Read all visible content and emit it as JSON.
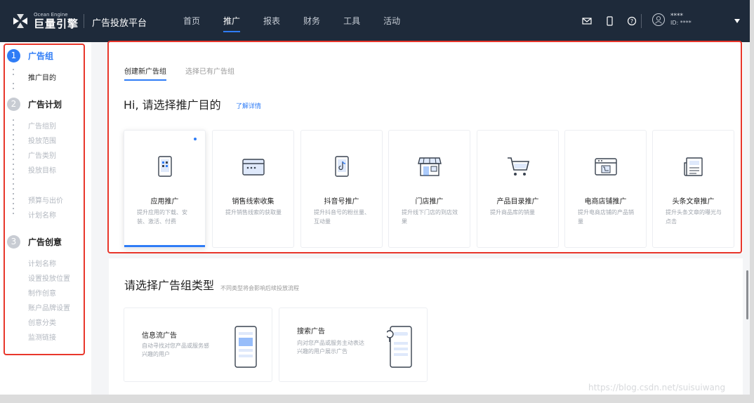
{
  "brand": {
    "logo_en": "Ocean Engine",
    "logo_cn": "巨量引擎",
    "platform": "广告投放平台"
  },
  "nav": [
    {
      "label": "首页"
    },
    {
      "label": "推广",
      "active": true
    },
    {
      "label": "报表"
    },
    {
      "label": "财务"
    },
    {
      "label": "工具"
    },
    {
      "label": "活动"
    }
  ],
  "user": {
    "name": "****",
    "id": "ID: ****"
  },
  "sidebar": {
    "steps": [
      {
        "num": "1",
        "title": "广告组",
        "items": [
          "推广目的"
        ]
      },
      {
        "num": "2",
        "title": "广告计划",
        "items": [
          "广告组别",
          "投放范围",
          "广告类别",
          "投放目标",
          "预算与出价",
          "计划名称"
        ]
      },
      {
        "num": "3",
        "title": "广告创意",
        "items": [
          "计划名称",
          "设置投放位置",
          "制作创意",
          "账户品牌设置",
          "创意分类",
          "监测链接"
        ]
      }
    ]
  },
  "tabs": [
    "创建新广告组",
    "选择已有广告组"
  ],
  "heading": "Hi, 请选择推广目的",
  "learn_more": "了解详情",
  "purposes": [
    {
      "title": "应用推广",
      "desc": "提升应用的下载、安装、激活、付费",
      "icon": "phone-app-icon"
    },
    {
      "title": "销售线索收集",
      "desc": "提升销售线索的获取量",
      "icon": "browser-window-icon"
    },
    {
      "title": "抖音号推广",
      "desc": "提升抖音号的粉丝量、互动量",
      "icon": "douyin-phone-icon"
    },
    {
      "title": "门店推广",
      "desc": "提升线下门店的到店效果",
      "icon": "store-icon"
    },
    {
      "title": "产品目录推广",
      "desc": "提升商品库的销量",
      "icon": "shopping-cart-icon"
    },
    {
      "title": "电商店铺推广",
      "desc": "提升电商店铺的产品销量",
      "icon": "shop-window-icon"
    },
    {
      "title": "头条文章推广",
      "desc": "提升头条文章的曝光与点击",
      "icon": "newspaper-icon"
    }
  ],
  "type_section": {
    "heading": "请选择广告组类型",
    "note": "不同类型将会影响后续投放流程",
    "types": [
      {
        "title": "信息流广告",
        "desc": "自动寻找对您产品或服务感兴趣的用户",
        "icon": "feed-phone-icon"
      },
      {
        "title": "搜索广告",
        "desc": "向对您产品或服务主动表达兴趣的用户展示广告",
        "icon": "search-phone-icon"
      }
    ]
  },
  "watermark": "https://blog.csdn.net/suisuiwang",
  "colors": {
    "accent": "#2f7cf6",
    "topbar": "#1e2a3a",
    "highlight_box": "#e8362b"
  }
}
